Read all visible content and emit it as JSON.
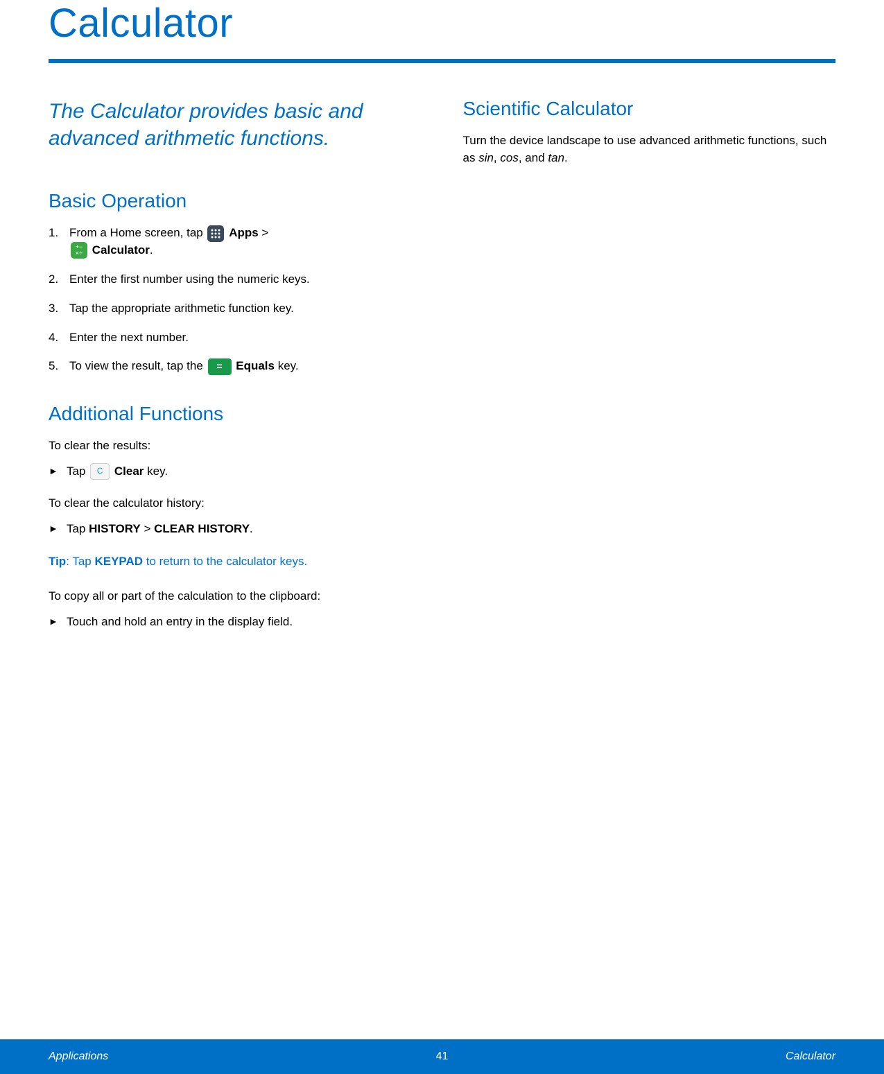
{
  "title": "Calculator",
  "intro": "The Calculator provides basic and advanced arithmetic functions.",
  "basic": {
    "heading": "Basic Operation",
    "step1_a": "From a Home screen, tap ",
    "step1_apps": "Apps",
    "step1_gt": " > ",
    "step1_calc": "Calculator",
    "step1_end": ".",
    "step2": "Enter the first number using the numeric keys.",
    "step3": "Tap the appropriate arithmetic function key.",
    "step4": "Enter the next number.",
    "step5_a": "To view the result, tap the ",
    "step5_equals": "Equals",
    "step5_b": " key."
  },
  "additional": {
    "heading": "Additional Functions",
    "clear_results": "To clear the results:",
    "clear_tap_a": "Tap ",
    "clear_label": "Clear",
    "clear_tap_b": " key.",
    "history_intro": "To clear the calculator history:",
    "history_tap_a": "Tap ",
    "history_bold": "HISTORY",
    "history_gt": " > ",
    "history_bold2": "CLEAR HISTORY",
    "history_end": ".",
    "tip_label": "Tip",
    "tip_a": ": Tap ",
    "tip_bold": "KEYPAD",
    "tip_b": " to return to the calculator keys.",
    "copy_intro": "To copy all or part of the calculation to the clipboard:",
    "copy_step": "Touch and hold an entry in the display field."
  },
  "scientific": {
    "heading": "Scientific Calculator",
    "body_a": "Turn the device landscape to use advanced arithmetic functions, such as ",
    "sin": "sin",
    "sep1": ", ",
    "cos": "cos",
    "sep2": ", and ",
    "tan": "tan",
    "body_b": "."
  },
  "icons": {
    "clear_glyph": "C",
    "equals_glyph": "="
  },
  "footer": {
    "left": "Applications",
    "center": "41",
    "right": "Calculator"
  }
}
